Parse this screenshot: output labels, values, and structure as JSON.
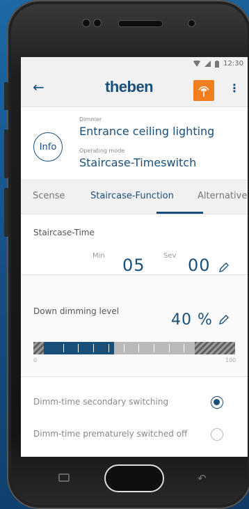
{
  "status_bar": {
    "time": "12:30"
  },
  "app_bar": {
    "back_icon": "arrow-left-icon",
    "logo_text": "theben",
    "menu_icon": "more-vert-icon",
    "antenna_color": "#f07d1e"
  },
  "device": {
    "info_label": "Info",
    "type_label": "Dimmer",
    "name": "Entrance ceiling lighting",
    "mode_label": "Operating mode",
    "mode": "Staircase-Timeswitch"
  },
  "tabs": [
    {
      "label": "Scense",
      "active": false
    },
    {
      "label": "Staircase-Function",
      "active": true
    },
    {
      "label": "Alternative",
      "active": false
    }
  ],
  "staircase_time": {
    "label": "Staircase-Time",
    "min_label": "Min",
    "min_value": "05",
    "sec_label": "Sev",
    "sec_value": "00"
  },
  "down_dimming": {
    "label": "Down dimming level",
    "value": "40 %",
    "level_percent": 40,
    "scale_min": "0",
    "scale_max": "100"
  },
  "radio_options": [
    {
      "label": "Dimm-time secondary switching",
      "selected": true
    },
    {
      "label": "Dimm-time prematurely switched off",
      "selected": false
    }
  ],
  "colors": {
    "accent": "#1a4f7a",
    "orange": "#f07d1e"
  }
}
